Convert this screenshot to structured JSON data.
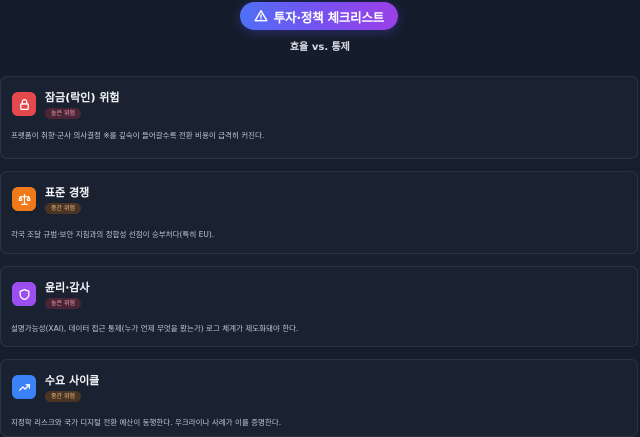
{
  "header": {
    "title": "투자·정책 체크리스트",
    "icon": "warning-triangle-icon",
    "subtitle": "효율 vs. 통제",
    "accent_gradient": [
      "#4f6ff6",
      "#9b3fe8"
    ]
  },
  "cards": [
    {
      "title": "잠금(락인) 위험",
      "badge": "높은 위험",
      "icon": "lock-icon",
      "icon_color": "#e5484d",
      "description": "프랫폼이 취향·군사 의사결정 ※를 깊숙이 들어갈수록 전환 비용이 급격히 커진다."
    },
    {
      "title": "표준 경쟁",
      "badge": "중간 위험",
      "icon": "scale-icon",
      "icon_color": "#f07a1a",
      "description": "각국 조달 규범·보안 지침과의 정합성 선점이 승부처다(특히 EU)."
    },
    {
      "title": "윤리·감사",
      "badge": "높은 위험",
      "icon": "shield-icon",
      "icon_color": "#9b4ff0",
      "description": "설명가능성(XAI), 데이터 접근 통제(누가 언제 무엇을 봤는가) 로그 체계가 제도화돼야 한다."
    },
    {
      "title": "수요 사이클",
      "badge": "중간 위험",
      "icon": "trending-up-icon",
      "icon_color": "#3b82f6",
      "description": "지정학 리스크와 국가 디지털 전환 예산이 동행한다. 우크라이나 사례가 이를 증명한다."
    }
  ]
}
